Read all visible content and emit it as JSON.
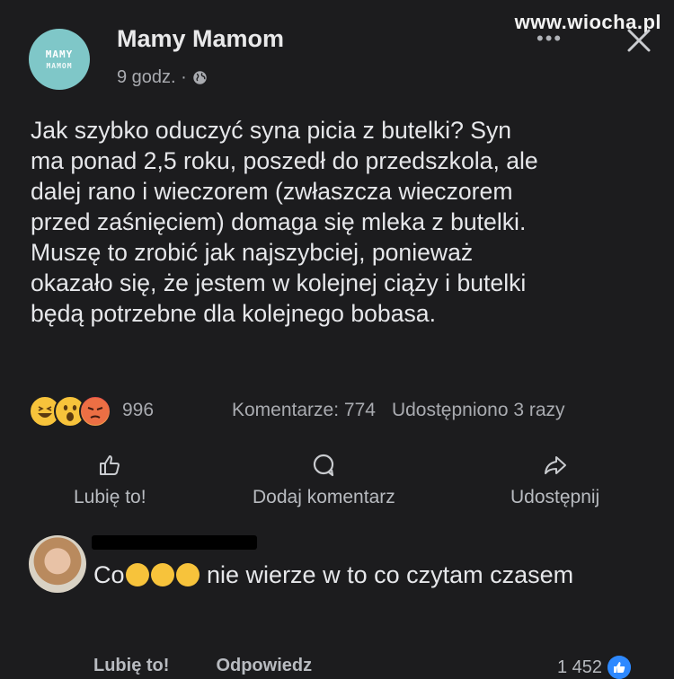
{
  "watermark": "www.wiocha.pl",
  "post": {
    "page_name": "Mamy Mamom",
    "avatar_text_line1": "MAMY",
    "avatar_text_line2": "MAMOM",
    "time": "9 godz. ·",
    "text": "Jak szybko oduczyć syna picia z butelki? Syn\nma ponad 2,5 roku, poszedł do przedszkola, ale\ndalej rano i wieczorem (zwłaszcza wieczorem\nprzed zaśnięciem) domaga się mleka z butelki.\nMuszę to zrobić jak najszybciej, ponieważ\nokazało się, że jestem w kolejnej ciąży i butelki\nbędą potrzebne dla kolejnego bobasa.",
    "reaction_count": "996",
    "comments_count": "Komentarze: 774",
    "shares_count": "Udostępniono 3 razy"
  },
  "actions": {
    "like": "Lubię to!",
    "comment": "Dodaj komentarz",
    "share": "Udostępnij"
  },
  "comment": {
    "text_prefix": "Co",
    "text_suffix": " nie wierze w to co czytam czasem",
    "like_label": "Lubię to!",
    "reply_label": "Odpowiedz",
    "likes": "1 452"
  },
  "icons": [
    "globe-icon",
    "more-icon",
    "close-icon",
    "like-icon",
    "comment-icon",
    "share-icon"
  ],
  "colors": {
    "background": "#1c1c1e",
    "avatar": "#7fc7c8",
    "like_blue": "#2e89ff"
  }
}
